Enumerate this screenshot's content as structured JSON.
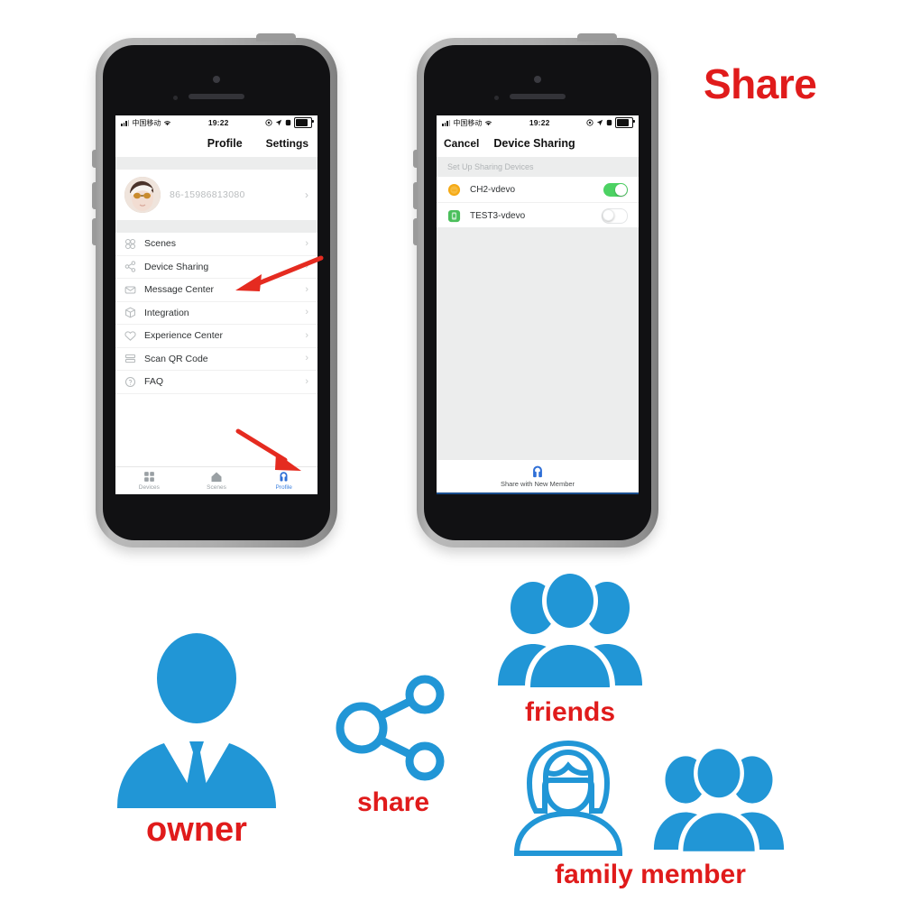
{
  "headline": "Share",
  "phone1": {
    "statusbar": {
      "carrier": "中国移动",
      "time": "19:22",
      "wifi_icon": "wifi-icon",
      "signal_icon": "signal-bars-icon",
      "alarm_icon": "alarm-icon",
      "location_icon": "location-arrow-icon",
      "lock_icon": "rotation-lock-icon",
      "battery_icon": "battery-icon"
    },
    "navbar": {
      "title": "Profile",
      "action": "Settings"
    },
    "profile": {
      "phone_number": "86-15986813080",
      "avatar_icon": "user-avatar",
      "chevron_icon": "chevron-right-icon"
    },
    "menu": [
      {
        "label": "Scenes",
        "icon": "scenes-grid-icon"
      },
      {
        "label": "Device Sharing",
        "icon": "share-nodes-icon"
      },
      {
        "label": "Message Center",
        "icon": "envelope-icon"
      },
      {
        "label": "Integration",
        "icon": "cube-icon"
      },
      {
        "label": "Experience Center",
        "icon": "heart-icon"
      },
      {
        "label": "Scan QR Code",
        "icon": "scan-lines-icon"
      },
      {
        "label": "FAQ",
        "icon": "question-circle-icon"
      }
    ],
    "tabs": [
      {
        "label": "Devices",
        "icon": "grid-squares-icon",
        "active": false
      },
      {
        "label": "Scenes",
        "icon": "home-icon",
        "active": false
      },
      {
        "label": "Profile",
        "icon": "person-icon",
        "active": true
      }
    ]
  },
  "phone2": {
    "statusbar": {
      "carrier": "中国移动",
      "time": "19:22"
    },
    "navbar": {
      "cancel": "Cancel",
      "title": "Device Sharing"
    },
    "section_header": "Set Up Sharing Devices",
    "devices": [
      {
        "name": "CH2-vdevo",
        "icon": "orange-round-device-icon",
        "toggle": "on"
      },
      {
        "name": "TEST3-vdevo",
        "icon": "green-square-device-icon",
        "toggle": "off"
      }
    ],
    "share_button": {
      "label": "Share with New Member",
      "icon": "person-icon"
    }
  },
  "illustration": {
    "owner": {
      "caption": "owner",
      "icon": "businessman-icon"
    },
    "share": {
      "caption": "share",
      "icon": "share-nodes-icon"
    },
    "friends": {
      "caption": "friends",
      "icon": "group-of-three-filled-icon"
    },
    "family": {
      "caption": "family member",
      "icon_left": "woman-outline-icon",
      "icon_right": "group-of-three-filled-icon"
    }
  },
  "colors": {
    "accent_blue": "#2196d6",
    "caption_red": "#e01b1b",
    "toggle_on_green": "#4cd263",
    "tab_active_blue": "#3d82e0",
    "arrow_red": "#e52b20"
  }
}
